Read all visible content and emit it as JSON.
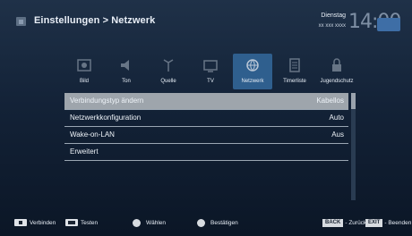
{
  "header": {
    "breadcrumb": "Einstellungen > Netzwerk",
    "day": "Dienstag",
    "date": "xx xxx xxxx",
    "time": "14:00"
  },
  "tabs": [
    {
      "label": "Bild",
      "icon": "picture-icon"
    },
    {
      "label": "Ton",
      "icon": "speaker-icon"
    },
    {
      "label": "Quelle",
      "icon": "antenna-icon"
    },
    {
      "label": "TV",
      "icon": "tv-icon"
    },
    {
      "label": "Netzwerk",
      "icon": "globe-icon",
      "active": true
    },
    {
      "label": "Timerliste",
      "icon": "timer-list-icon"
    },
    {
      "label": "Jugendschutz",
      "icon": "parental-lock-icon"
    }
  ],
  "menu": {
    "items": [
      {
        "label": "Verbindungstyp ändern",
        "value": "Kabellos",
        "selected": true
      },
      {
        "label": "Netzwerkkonfiguration",
        "value": "Auto"
      },
      {
        "label": "Wake-on-LAN",
        "value": "Aus"
      },
      {
        "label": "Erweitert",
        "value": ""
      }
    ]
  },
  "footer": {
    "items": [
      {
        "label": "Verbinden"
      },
      {
        "label": "Testen"
      },
      {
        "label": "Wählen"
      },
      {
        "label": "Bestätigen"
      },
      {
        "key": "BACK",
        "label": "- Zurück"
      },
      {
        "key": "EXIT",
        "label": "- Beenden"
      }
    ]
  },
  "colors": {
    "background": "#132237",
    "active_tab": "#2f5f8e",
    "selected_row": "#9ea5ac",
    "time_accent": "#3e6ea6"
  }
}
